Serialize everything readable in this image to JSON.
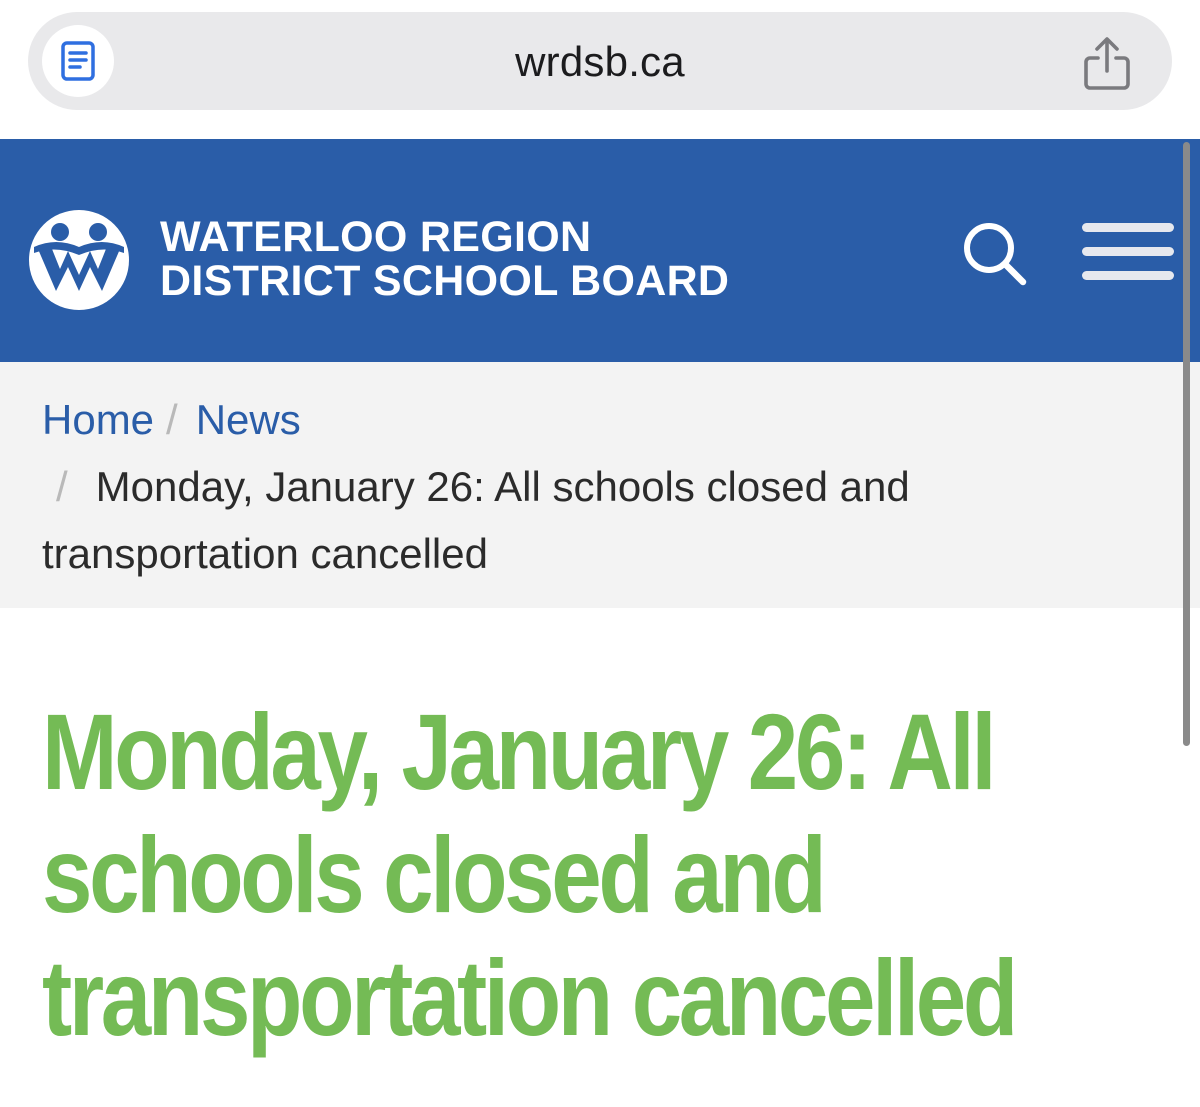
{
  "browser": {
    "url": "wrdsb.ca",
    "reader_icon": "reader-mode-icon",
    "share_icon": "share-icon"
  },
  "header": {
    "logo_line1": "WATERLOO REGION",
    "logo_line2": "DISTRICT SCHOOL BOARD",
    "logo_icon": "wrdsb-logo",
    "search_icon": "search-icon",
    "menu_icon": "hamburger-menu-icon",
    "colors": {
      "background": "#2a5da8",
      "text": "#ffffff"
    }
  },
  "breadcrumb": {
    "home": "Home",
    "news": "News",
    "separator": "/",
    "current_line1": "Monday, January 26: All schools closed and",
    "current_line2": "transportation cancelled"
  },
  "article": {
    "title_line1": "Monday, January 26: All",
    "title_line2": "schools closed and",
    "title_line3": "transportation cancelled",
    "title_color": "#74bb55"
  }
}
